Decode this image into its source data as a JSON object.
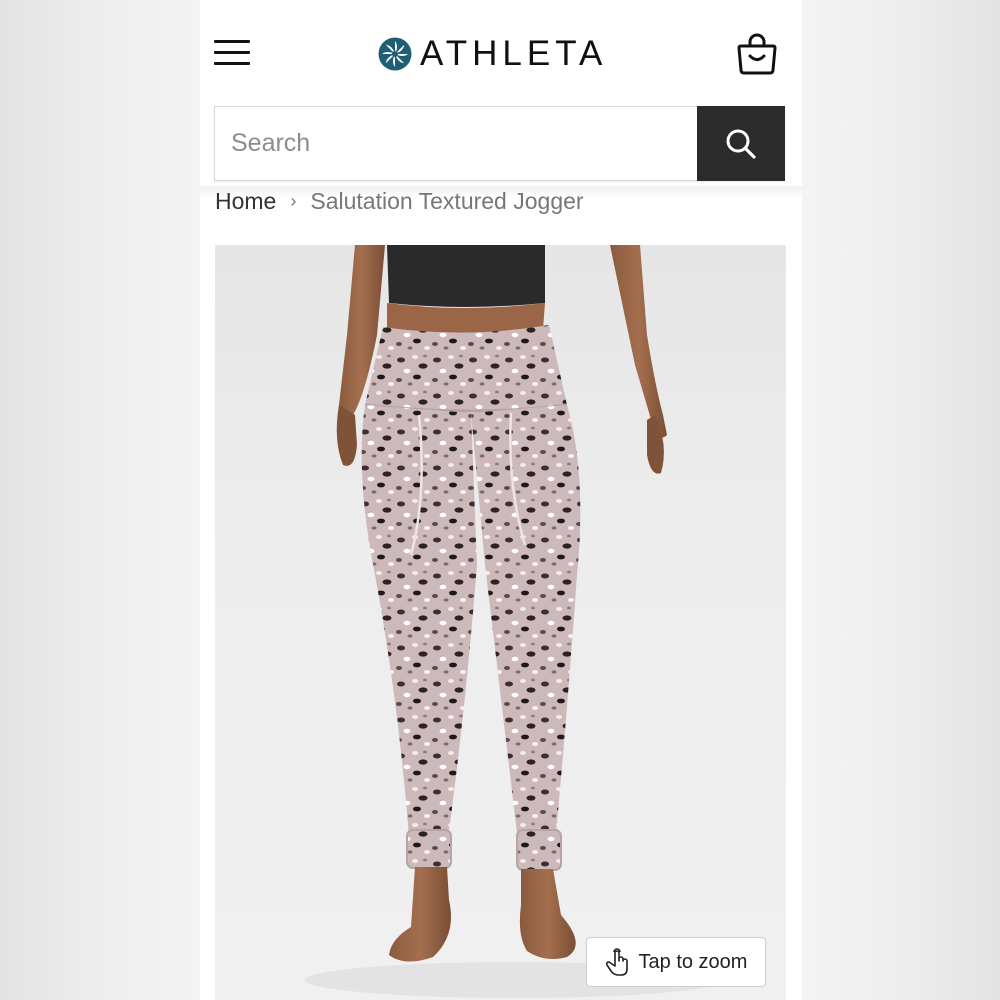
{
  "header": {
    "brand": "ATHLETA",
    "menu_icon": "hamburger-menu-icon",
    "bag_icon": "shopping-bag-icon"
  },
  "search": {
    "placeholder": "Search",
    "value": "",
    "button_icon": "search-icon"
  },
  "breadcrumb": {
    "home": "Home",
    "separator": "›",
    "current": "Salutation Textured Jogger"
  },
  "product_image": {
    "description_icon": "product-photo",
    "zoom_label": "Tap to zoom",
    "zoom_icon": "tap-hand-icon"
  },
  "colors": {
    "search_button": "#2b2b2b",
    "logo_mark": "#1f5e73",
    "pants_base": "#c9b4b6"
  }
}
